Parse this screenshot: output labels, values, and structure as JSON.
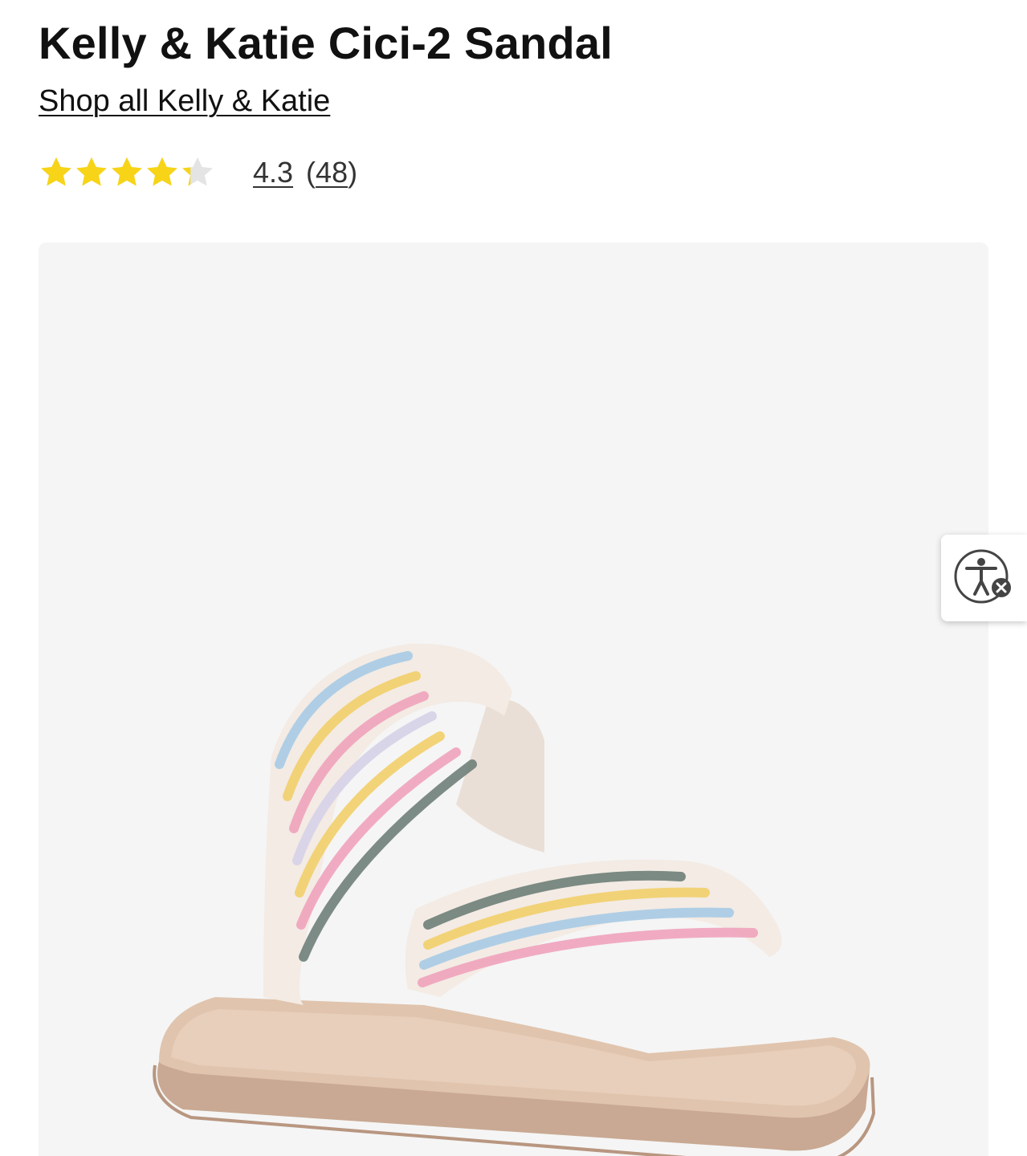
{
  "product": {
    "title": "Kelly & Katie Cici-2 Sandal",
    "brand_link": "Shop all Kelly & Katie",
    "rating": {
      "value": 4.3,
      "value_label": "4.3",
      "max": 5,
      "count_label": "48",
      "open_paren": "(",
      "close_paren": ")"
    },
    "image_alt": "Kelly & Katie Cici-2 Sandal",
    "image_icon": "product-photo"
  },
  "accessibility_widget": {
    "icon": "accessibility-person-icon",
    "badge_icon": "close-icon"
  },
  "colors": {
    "star_fill": "#f7d417",
    "star_empty": "#e4e4e4",
    "image_bg": "#f5f5f5",
    "text": "#111111"
  }
}
